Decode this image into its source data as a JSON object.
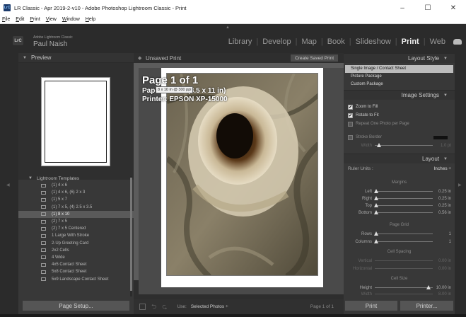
{
  "window": {
    "app_icon": "LrC",
    "title": "LR Classic - Apr 2019-2-v10 - Adobe Photoshop Lightroom Classic - Print",
    "minimize": "–",
    "maximize": "☐",
    "close": "✕"
  },
  "menu": [
    {
      "u": "F",
      "rest": "ile"
    },
    {
      "u": "E",
      "rest": "dit"
    },
    {
      "u": "P",
      "rest": "rint"
    },
    {
      "u": "V",
      "rest": "iew"
    },
    {
      "u": "W",
      "rest": "indow"
    },
    {
      "u": "H",
      "rest": "elp"
    }
  ],
  "identity": {
    "badge": "LrC",
    "product": "Adobe Lightroom Classic",
    "user": "Paul Naish"
  },
  "modules": [
    "Library",
    "Develop",
    "Map",
    "Book",
    "Slideshow",
    "Print",
    "Web"
  ],
  "left_panel": {
    "preview_title": "Preview",
    "templates_title": "Lightroom Templates",
    "templates": [
      "(1) 4 x 6",
      "(1) 4 x 6, (6) 2 x 3",
      "(1) 5 x 7",
      "(1) 7 x 5, (4) 2.5 x 3.5",
      "(1) 8 x 10",
      "(2) 7 x 5",
      "(2) 7 x 5 Centered",
      "1 Large With Stroke",
      "2-Up Greeting Card",
      "2x2 Cells",
      "4 Wide",
      "4x5 Contact Sheet",
      "5x8 Contact Sheet",
      "5x9 Landscape Contact Sheet"
    ],
    "selected_template": 4,
    "page_setup": "Page Setup..."
  },
  "center": {
    "title": "Unsaved Print",
    "create_saved": "Create Saved Print",
    "page_num": "Page 1 of 1",
    "paper": "Paper:  Letter (8.5 x 11 in)",
    "printer": "Printer:  EPSON XP-15000",
    "tooltip": "8 x 10 in @ 300 ppi",
    "toolbar": {
      "use_label": "Use:",
      "use_value": "Selected Photos ÷",
      "page": "Page 1 of 1"
    }
  },
  "right_panel": {
    "layout_style_title": "Layout Style",
    "styles": [
      "Single Image / Contact Sheet",
      "Picture Package",
      "Custom Package"
    ],
    "image_settings_title": "Image Settings",
    "zoom_to_fill": "Zoom to Fill",
    "rotate_to_fit": "Rotate to Fit",
    "repeat_one": "Repeat One Photo per Page",
    "stroke_border": "Stroke Border",
    "stroke_width_label": "Width",
    "stroke_width_value": "1.0 pt",
    "layout_title": "Layout",
    "ruler_units_label": "Ruler Units :",
    "ruler_units_value": "Inches ÷",
    "margins_title": "Margins",
    "margins": [
      {
        "label": "Left",
        "value": "0.25 in",
        "level": 0.02
      },
      {
        "label": "Right",
        "value": "0.25 in",
        "level": 0.02
      },
      {
        "label": "Top",
        "value": "0.25 in",
        "level": 0.02
      },
      {
        "label": "Bottom",
        "value": "0.56 in",
        "level": 0.02
      }
    ],
    "page_grid_title": "Page Grid",
    "rows": {
      "label": "Rows",
      "value": "1",
      "level": 0.02
    },
    "columns": {
      "label": "Columns",
      "value": "1",
      "level": 0.02
    },
    "cell_spacing_title": "Cell Spacing",
    "vertical": {
      "label": "Vertical",
      "value": "0.00 in"
    },
    "horizontal": {
      "label": "Horizontal",
      "value": "0.00 in"
    },
    "cell_size_title": "Cell Size",
    "height": {
      "label": "Height",
      "value": "10.00 in",
      "level": 0.93
    },
    "width": {
      "label": "Width",
      "value": "8.00 in"
    },
    "print": "Print",
    "printer": "Printer..."
  },
  "colors": {
    "panel_bg": "#383838",
    "selected_style": "#bcbcbc",
    "active_module": "#eeeeee"
  }
}
